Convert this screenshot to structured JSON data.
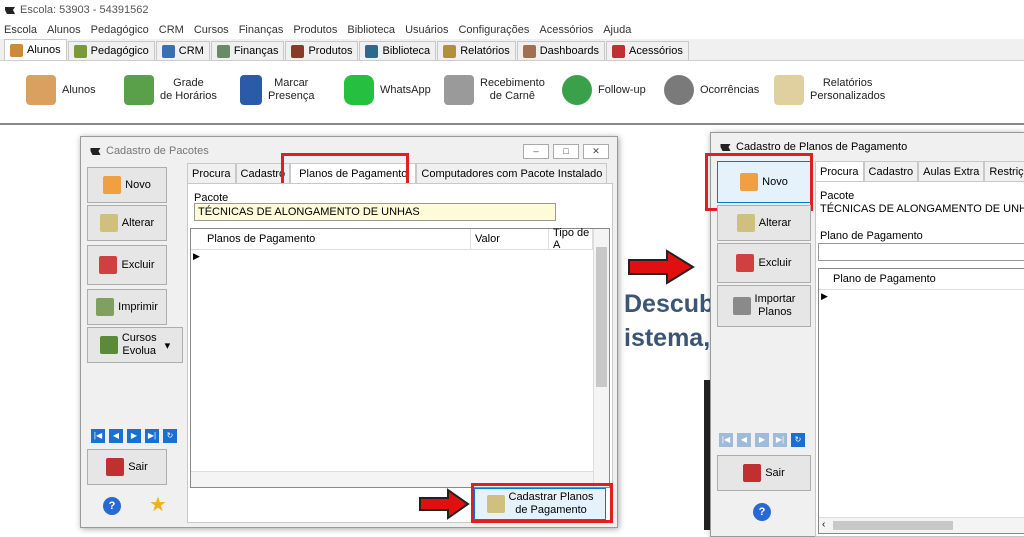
{
  "app": {
    "title": "Escola: 53903 - 54391562"
  },
  "menu": [
    "Escola",
    "Alunos",
    "Pedagógico",
    "CRM",
    "Cursos",
    "Finanças",
    "Produtos",
    "Biblioteca",
    "Usuários",
    "Configurações",
    "Acessórios",
    "Ajuda"
  ],
  "tabs": [
    "Alunos",
    "Pedagógico",
    "CRM",
    "Finanças",
    "Produtos",
    "Biblioteca",
    "Relatórios",
    "Dashboards",
    "Acessórios"
  ],
  "ribbon": {
    "alunos": "Alunos",
    "grade1": "Grade",
    "grade2": "de Horários",
    "marcar1": "Marcar",
    "marcar2": "Presença",
    "whatsapp": "WhatsApp",
    "receb1": "Recebimento",
    "receb2": "de Carnê",
    "followup": "Follow-up",
    "ocorrencias": "Ocorrências",
    "relat1": "Relatórios",
    "relat2": "Personalizados"
  },
  "background": {
    "line1": "Descub",
    "line2": "istema,"
  },
  "win1": {
    "title": "Cadastro de Pacotes",
    "btn_novo": "Novo",
    "btn_alterar": "Alterar",
    "btn_excluir": "Excluir",
    "btn_imprimir": "Imprimir",
    "btn_cursos1": "Cursos",
    "btn_cursos2": "Evolua",
    "btn_sair": "Sair",
    "tabs": [
      "Procura",
      "Cadastro",
      "Planos de Pagamento",
      "Computadores com Pacote Instalado"
    ],
    "pacote_label": "Pacote",
    "pacote_value": "TÉCNICAS DE ALONGAMENTO DE UNHAS",
    "cols": [
      "Planos de Pagamento",
      "Valor",
      "Tipo de A"
    ],
    "cad1": "Cadastrar Planos",
    "cad2": "de Pagamento"
  },
  "win2": {
    "title": "Cadastro de Planos de Pagamento",
    "btn_novo": "Novo",
    "btn_alterar": "Alterar",
    "btn_excluir": "Excluir",
    "btn_importar1": "Importar",
    "btn_importar2": "Planos",
    "btn_sair": "Sair",
    "tabs": [
      "Procura",
      "Cadastro",
      "Aulas Extra",
      "Restriçõ"
    ],
    "pacote_label": "Pacote",
    "pacote_value": "TÉCNICAS DE ALONGAMENTO DE UNHAS",
    "plano_label": "Plano de Pagamento",
    "col": "Plano de Pagamento"
  },
  "colors": {
    "highlight": "#e02020",
    "arrow": "#e01010"
  }
}
